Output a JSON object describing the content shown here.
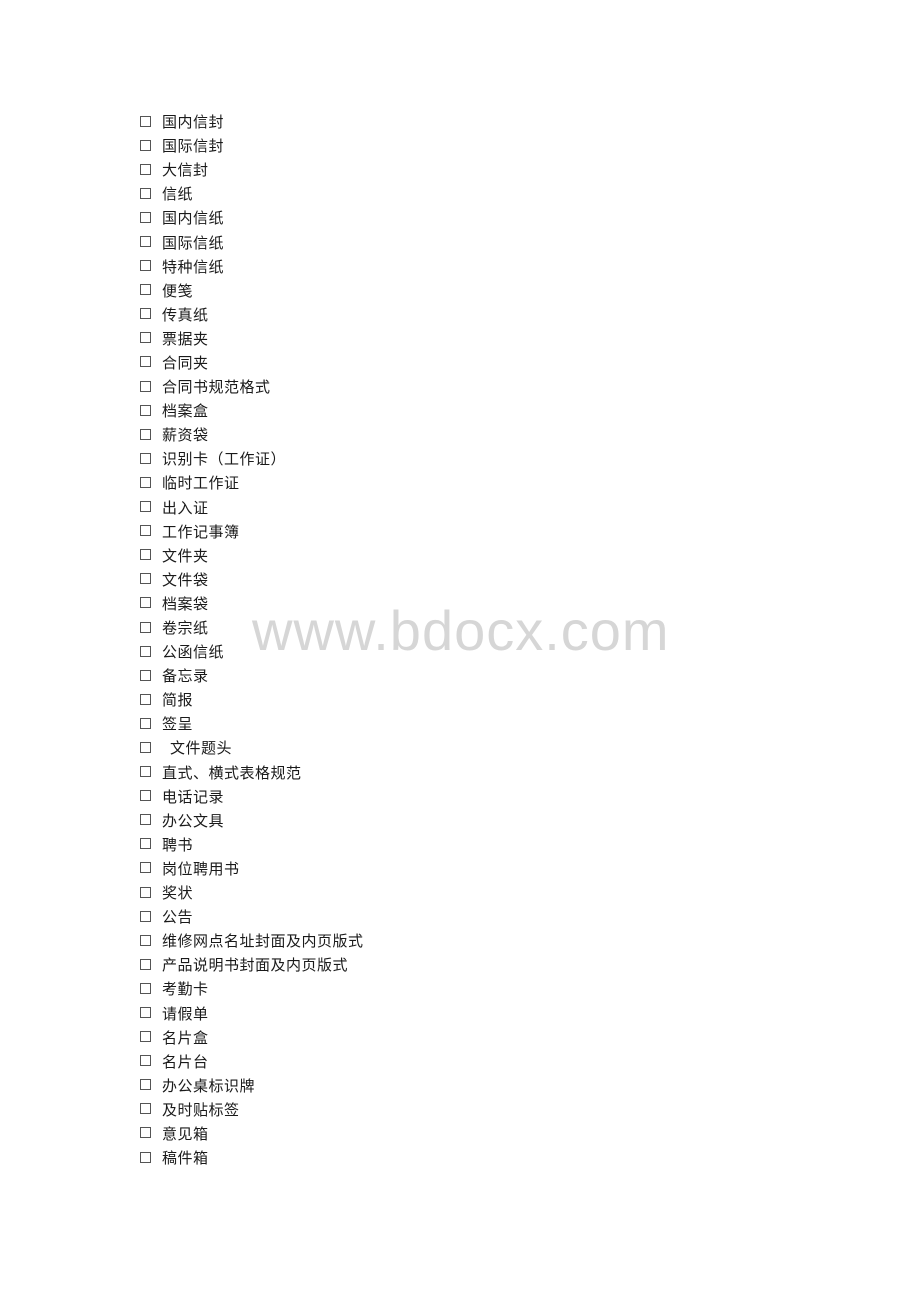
{
  "checklist": {
    "items": [
      {
        "label": "国内信封",
        "checked": false
      },
      {
        "label": "国际信封",
        "checked": false
      },
      {
        "label": "大信封",
        "checked": false
      },
      {
        "label": "信纸",
        "checked": false
      },
      {
        "label": "国内信纸",
        "checked": false
      },
      {
        "label": "国际信纸",
        "checked": false
      },
      {
        "label": "特种信纸",
        "checked": false
      },
      {
        "label": "便笺",
        "checked": false
      },
      {
        "label": "传真纸",
        "checked": false
      },
      {
        "label": "票据夹",
        "checked": false
      },
      {
        "label": "合同夹",
        "checked": false
      },
      {
        "label": "合同书规范格式",
        "checked": false
      },
      {
        "label": "档案盒",
        "checked": false
      },
      {
        "label": "薪资袋",
        "checked": false
      },
      {
        "label": "识别卡（工作证）",
        "checked": false
      },
      {
        "label": "临时工作证",
        "checked": false
      },
      {
        "label": "出入证",
        "checked": false
      },
      {
        "label": "工作记事簿",
        "checked": false
      },
      {
        "label": "文件夹",
        "checked": false
      },
      {
        "label": "文件袋",
        "checked": false
      },
      {
        "label": "档案袋",
        "checked": false
      },
      {
        "label": "卷宗纸",
        "checked": false
      },
      {
        "label": "公函信纸",
        "checked": false
      },
      {
        "label": "备忘录",
        "checked": false
      },
      {
        "label": "简报",
        "checked": false
      },
      {
        "label": "签呈",
        "checked": false
      },
      {
        "label": "文件题头",
        "checked": false,
        "indented": true
      },
      {
        "label": "直式、横式表格规范",
        "checked": false
      },
      {
        "label": "电话记录",
        "checked": false
      },
      {
        "label": "办公文具",
        "checked": false
      },
      {
        "label": "聘书",
        "checked": false
      },
      {
        "label": "岗位聘用书",
        "checked": false
      },
      {
        "label": "奖状",
        "checked": false
      },
      {
        "label": "公告",
        "checked": false
      },
      {
        "label": "维修网点名址封面及内页版式",
        "checked": false
      },
      {
        "label": "产品说明书封面及内页版式",
        "checked": false
      },
      {
        "label": "考勤卡",
        "checked": false
      },
      {
        "label": "请假单",
        "checked": false
      },
      {
        "label": "名片盒",
        "checked": false
      },
      {
        "label": "名片台",
        "checked": false
      },
      {
        "label": "办公桌标识牌",
        "checked": false
      },
      {
        "label": "及时贴标签",
        "checked": false
      },
      {
        "label": "意见箱",
        "checked": false
      },
      {
        "label": "稿件箱",
        "checked": false
      }
    ]
  },
  "watermark": {
    "text": "www.bdocx.com"
  }
}
